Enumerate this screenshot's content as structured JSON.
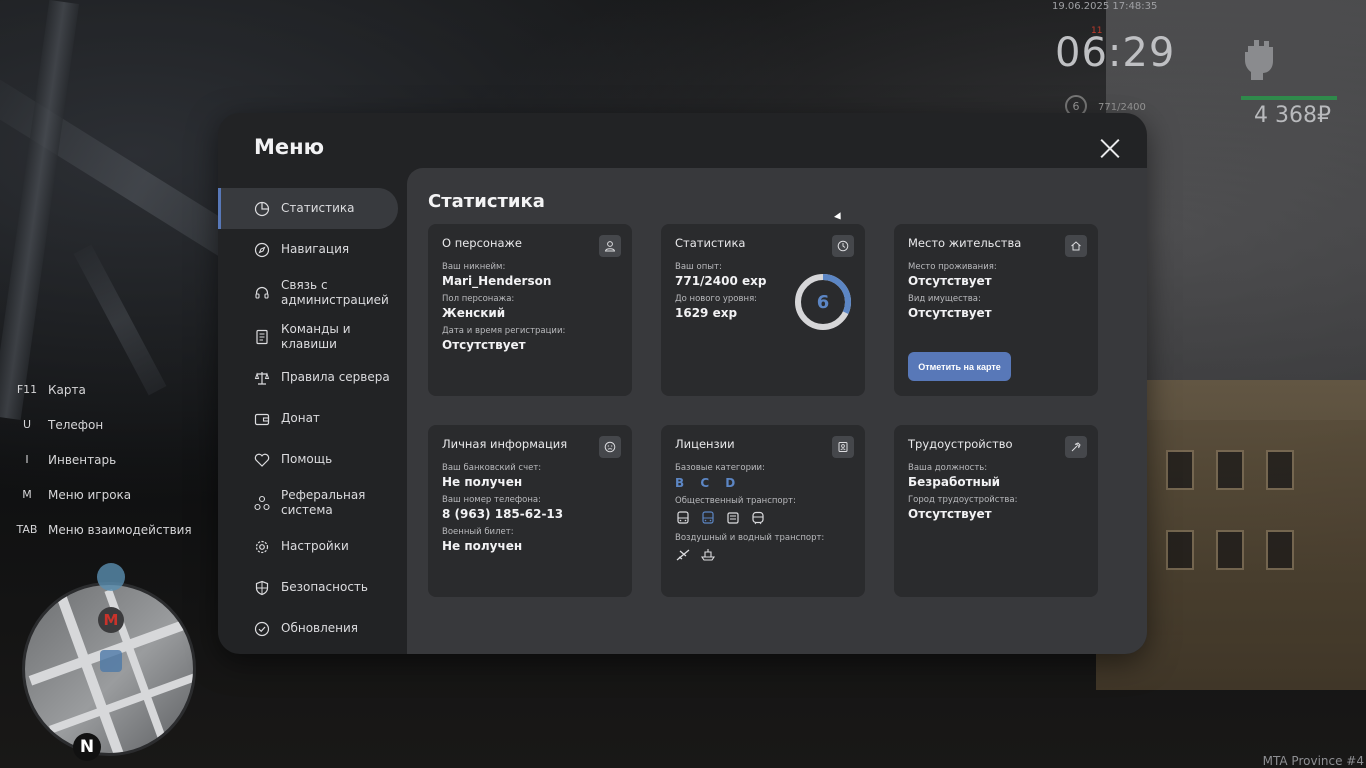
{
  "hud": {
    "datetime": "19.06.2025 17:48:35",
    "clock": "06:29",
    "level": "6",
    "exp": "771/2400",
    "money": "4 368₽",
    "marker": "11"
  },
  "hotkeys": [
    {
      "key": "F11",
      "label": "Карта"
    },
    {
      "key": "U",
      "label": "Телефон"
    },
    {
      "key": "I",
      "label": "Инвентарь"
    },
    {
      "key": "M",
      "label": "Меню игрока"
    },
    {
      "key": "TAB",
      "label": "Меню взаимодействия"
    }
  ],
  "minimap": {
    "north": "N",
    "metro": "M"
  },
  "server_name": "MTA Province #4",
  "menu": {
    "title": "Меню",
    "sidebar": [
      {
        "label": "Статистика",
        "icon": "pie-chart-icon",
        "active": true
      },
      {
        "label": "Навигация",
        "icon": "compass-icon"
      },
      {
        "label": "Связь с администрацией",
        "icon": "headset-icon"
      },
      {
        "label": "Команды и клавиши",
        "icon": "document-icon"
      },
      {
        "label": "Правила сервера",
        "icon": "scales-icon"
      },
      {
        "label": "Донат",
        "icon": "wallet-icon"
      },
      {
        "label": "Помощь",
        "icon": "heart-icon"
      },
      {
        "label": "Реферальная система",
        "icon": "referral-icon"
      },
      {
        "label": "Настройки",
        "icon": "gear-icon"
      },
      {
        "label": "Безопасность",
        "icon": "shield-icon"
      },
      {
        "label": "Обновления",
        "icon": "check-circle-icon"
      }
    ],
    "content": {
      "title": "Статистика",
      "character": {
        "title": "О персонаже",
        "nickname_label": "Ваш никнейм:",
        "nickname": "Mari_Henderson",
        "gender_label": "Пол персонажа:",
        "gender": "Женский",
        "reg_label": "Дата и время регистрации:",
        "reg": "Отсутствует"
      },
      "stats": {
        "title": "Статистика",
        "exp_label": "Ваш опыт:",
        "exp": "771/2400 exp",
        "next_label": "До нового уровня:",
        "next": "1629 exp",
        "level": "6",
        "progress": 0.32,
        "ring_color": "#5c86c4"
      },
      "residence": {
        "title": "Место жительства",
        "place_label": "Место проживания:",
        "place": "Отсутствует",
        "property_label": "Вид имущества:",
        "property": "Отсутствует",
        "button": "Отметить на карте"
      },
      "personal": {
        "title": "Личная информация",
        "bank_label": "Ваш банковский счет:",
        "bank": "Не получен",
        "phone_label": "Ваш номер телефона:",
        "phone": "8 (963) 185-62-13",
        "military_label": "Военный билет:",
        "military": "Не получен"
      },
      "licenses": {
        "title": "Лицензии",
        "base_label": "Базовые категории:",
        "base": "B C D",
        "public_label": "Общественный транспорт:",
        "public_icons": [
          "bus-icon",
          "trolleybus-icon",
          "tram-icon",
          "train-icon"
        ],
        "air_label": "Воздушный и водный транспорт:",
        "air_icons": [
          "plane-icon",
          "boat-icon"
        ]
      },
      "employment": {
        "title": "Трудоустройство",
        "position_label": "Ваша должность:",
        "position": "Безработный",
        "city_label": "Город трудоустройства:",
        "city": "Отсутствует"
      }
    }
  },
  "colors": {
    "accent": "#5878b8",
    "panel": "#222325",
    "content": "#38393c",
    "card": "#2a2b2d"
  }
}
